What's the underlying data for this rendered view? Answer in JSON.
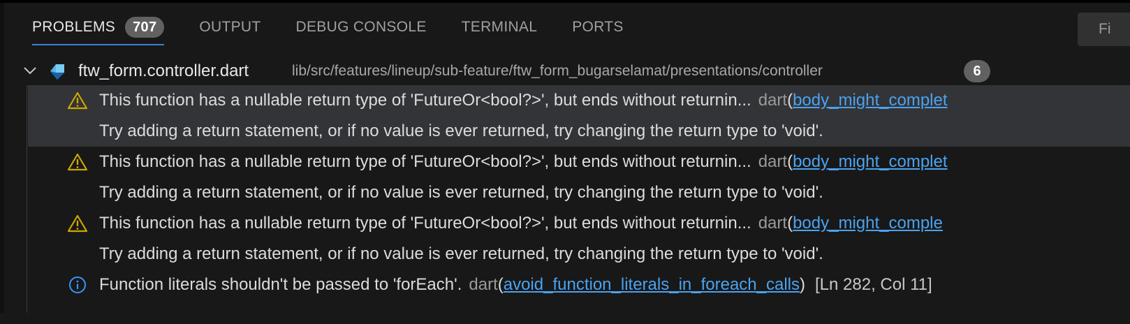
{
  "colors": {
    "panel_bg": "#181818",
    "selected_row_bg": "#333437",
    "tab_active_underline": "#3b82d6",
    "warning_icon": "#cca700",
    "info_icon": "#3794ff",
    "link": "#4aa3f0",
    "dart_icon_primary": "#5ab4e6",
    "dart_icon_secondary": "#1a5fa8"
  },
  "tabs": [
    {
      "label": "PROBLEMS",
      "badge": "707",
      "active": true
    },
    {
      "label": "OUTPUT"
    },
    {
      "label": "DEBUG CONSOLE"
    },
    {
      "label": "TERMINAL"
    },
    {
      "label": "PORTS"
    }
  ],
  "filter": {
    "text": "Fi"
  },
  "file_group": {
    "expanded_icon": "chevron-down-icon",
    "file_icon": "dart-file-icon",
    "file_name": "ftw_form.controller.dart",
    "path": "lib/src/features/lineup/sub-feature/ftw_form_bugarselamat/presentations/controller",
    "count": "6"
  },
  "problems": [
    {
      "severity": "warning",
      "icon": "warning-icon",
      "message": "This function has a nullable return type of 'FutureOr<bool?>', but ends without returnin...",
      "source": "dart",
      "code_open": "(",
      "code": "body_might_complet",
      "detail": "Try adding a return statement, or if no value is ever returned, try changing the return type to 'void'.",
      "selected": true
    },
    {
      "severity": "warning",
      "icon": "warning-icon",
      "message": "This function has a nullable return type of 'FutureOr<bool?>', but ends without returnin...",
      "source": "dart",
      "code_open": "(",
      "code": "body_might_complet",
      "detail": "Try adding a return statement, or if no value is ever returned, try changing the return type to 'void'."
    },
    {
      "severity": "warning",
      "icon": "warning-icon",
      "message": "This function has a nullable return type of 'FutureOr<bool?>', but ends without returnin...",
      "source": "dart",
      "code_open": "(",
      "code": "body_might_comple",
      "detail": "Try adding a return statement, or if no value is ever returned, try changing the return type to 'void'."
    },
    {
      "severity": "info",
      "icon": "info-icon",
      "message": "Function literals shouldn't be passed to 'forEach'.",
      "source": "dart",
      "code_open": "(",
      "code": "avoid_function_literals_in_foreach_calls",
      "code_close": ")",
      "location": "[Ln 282, Col 11]"
    }
  ]
}
